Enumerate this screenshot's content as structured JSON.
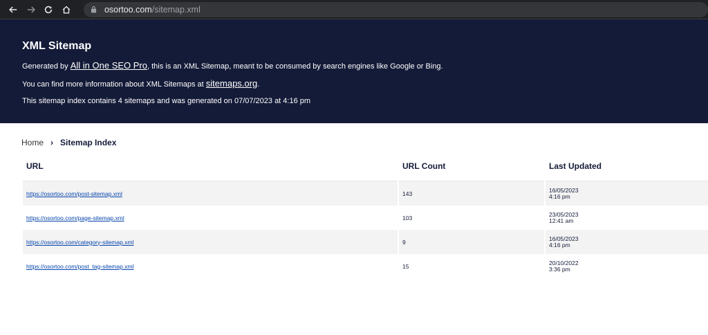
{
  "browser": {
    "url_host": "osortoo.com",
    "url_path": "/sitemap.xml"
  },
  "header": {
    "title": "XML Sitemap",
    "line1_prefix": "Generated by ",
    "line1_link": "All in One SEO Pro",
    "line1_suffix": ", this is an XML Sitemap, meant to be consumed by search engines like Google or Bing.",
    "line2_prefix": "You can find more information about XML Sitemaps at ",
    "line2_link": "sitemaps.org",
    "line2_suffix": ".",
    "line3": "This sitemap index contains 4 sitemaps and was generated on 07/07/2023 at 4:16 pm"
  },
  "breadcrumb": {
    "home": "Home",
    "separator": "›",
    "current": "Sitemap Index"
  },
  "table": {
    "headers": [
      "URL",
      "URL Count",
      "Last Updated"
    ],
    "rows": [
      {
        "url": "https://osortoo.com/post-sitemap.xml",
        "count": "143",
        "date": "16/05/2023",
        "time": "4:16 pm"
      },
      {
        "url": "https://osortoo.com/page-sitemap.xml",
        "count": "103",
        "date": "23/05/2023",
        "time": "12:41 am"
      },
      {
        "url": "https://osortoo.com/category-sitemap.xml",
        "count": "9",
        "date": "16/05/2023",
        "time": "4:16 pm"
      },
      {
        "url": "https://osortoo.com/post_tag-sitemap.xml",
        "count": "15",
        "date": "20/10/2022",
        "time": "3:36 pm"
      }
    ]
  },
  "colors": {
    "header_bg": "#141b38",
    "row_alt_bg": "#f3f3f3",
    "link": "#0645ad"
  }
}
